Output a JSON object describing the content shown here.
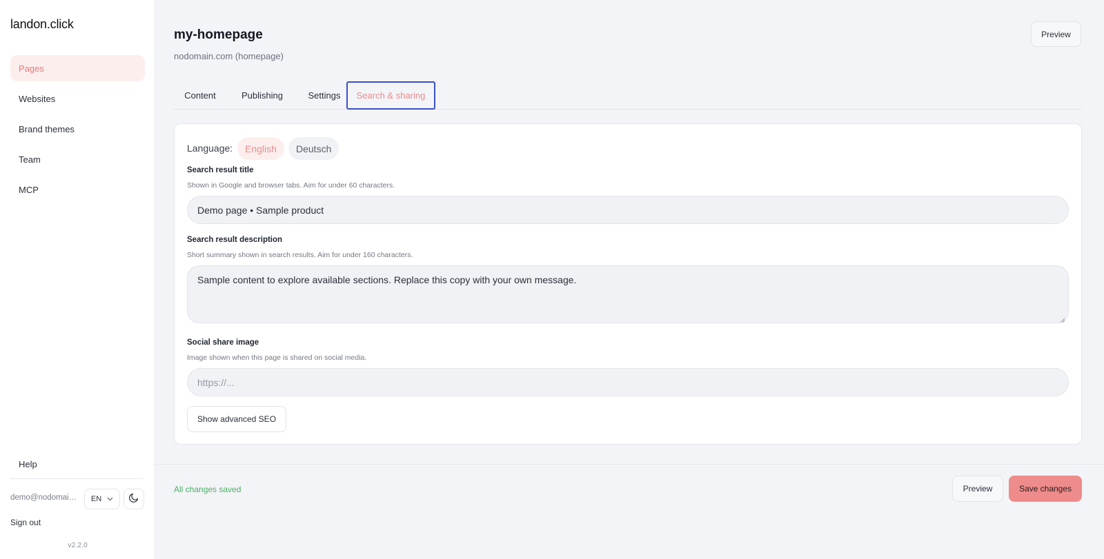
{
  "app": {
    "name": "landon.click",
    "version": "v2.2.0"
  },
  "sidebar": {
    "items": [
      {
        "label": "Pages"
      },
      {
        "label": "Websites"
      },
      {
        "label": "Brand themes"
      },
      {
        "label": "Team"
      },
      {
        "label": "MCP"
      }
    ],
    "help": "Help",
    "user_email": "demo@nodomain.com",
    "language": "EN",
    "theme_icon": "moon-icon",
    "sign_out": "Sign out"
  },
  "header": {
    "title": "my-homepage",
    "subtitle": "nodomain.com (homepage)",
    "preview": "Preview"
  },
  "tabs": [
    {
      "label": "Content"
    },
    {
      "label": "Publishing"
    },
    {
      "label": "Settings"
    },
    {
      "label": "Search & sharing"
    }
  ],
  "active_tab": "Search & sharing",
  "form": {
    "language_label": "Language:",
    "languages": [
      {
        "label": "English"
      },
      {
        "label": "Deutsch"
      }
    ],
    "active_language": "English",
    "search_title": {
      "label": "Search result title",
      "help": "Shown in Google and browser tabs. Aim for under 60 characters.",
      "value": "Demo page • Sample product"
    },
    "search_description": {
      "label": "Search result description",
      "help": "Short summary shown in search results. Aim for under 160 characters.",
      "value": "Sample content to explore available sections. Replace this copy with your own message."
    },
    "social_image": {
      "label": "Social share image",
      "help": "Image shown when this page is shared on social media.",
      "placeholder": "https://..."
    },
    "advanced_button": "Show advanced SEO"
  },
  "footer": {
    "status": "All changes saved",
    "preview": "Preview",
    "save": "Save changes"
  },
  "colors": {
    "accent": "#ee8b8b",
    "accent_soft": "#fdeeee",
    "focus": "#3b4fc4",
    "success": "#4caf66"
  }
}
